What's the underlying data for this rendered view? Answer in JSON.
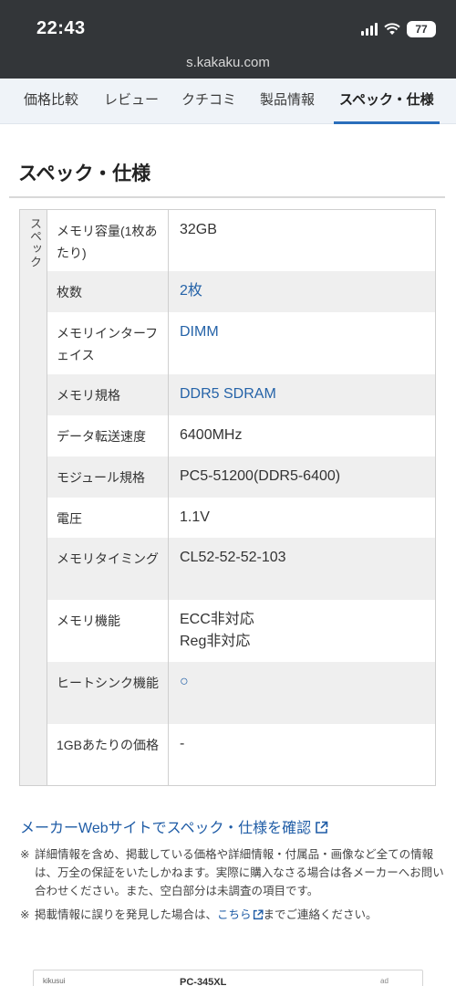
{
  "status_bar": {
    "time": "22:43",
    "battery": "77",
    "url": "s.kakaku.com"
  },
  "tabs": [
    {
      "label": "価格比較",
      "active": false
    },
    {
      "label": "レビュー",
      "active": false
    },
    {
      "label": "クチコミ",
      "active": false
    },
    {
      "label": "製品情報",
      "active": false
    },
    {
      "label": "スペック・仕様",
      "active": true
    }
  ],
  "page": {
    "title": "スペック・仕様",
    "section_label": "スペック"
  },
  "specs": [
    {
      "label": "メモリ容量(1枚あたり)",
      "value": "32GB",
      "link": false
    },
    {
      "label": "枚数",
      "value": "2枚",
      "link": true
    },
    {
      "label": "メモリインターフェイス",
      "value": "DIMM",
      "link": true
    },
    {
      "label": "メモリ規格",
      "value": "DDR5 SDRAM",
      "link": true
    },
    {
      "label": "データ転送速度",
      "value": "6400MHz",
      "link": false
    },
    {
      "label": "モジュール規格",
      "value": "PC5-51200(DDR5-6400)",
      "link": false
    },
    {
      "label": "電圧",
      "value": "1.1V",
      "link": false
    },
    {
      "label": "メモリタイミング",
      "value": "CL52-52-52-103",
      "link": false
    },
    {
      "label": "メモリ機能",
      "value": "ECC非対応\nReg非対応",
      "link": false
    },
    {
      "label": "ヒートシンク機能",
      "value": "○",
      "link": true
    },
    {
      "label": "1GBあたりの価格",
      "value": "-",
      "link": false
    }
  ],
  "footer": {
    "maker_link": "メーカーWebサイトでスペック・仕様を確認",
    "note1_mark": "※",
    "note1": "詳細情報を含め、掲載している価格や詳細情報・付属品・画像など全ての情報は、万全の保証をいたしかねます。実際に購入なさる場合は各メーカーへお問い合わせください。また、空白部分は未調査の項目です。",
    "note2_mark": "※",
    "note2_pre": "掲載情報に誤りを発見した場合は、",
    "note2_link": "こちら",
    "note2_post": "までご連絡ください。"
  },
  "bottom_panel": {
    "left_text": "kikusui",
    "center_text": "PC-345XL",
    "right_text": "ad"
  },
  "colors": {
    "status_bg": "#333639",
    "tab_bg": "#eff3f8",
    "accent": "#2a6ebb",
    "link": "#1f5ca6"
  }
}
